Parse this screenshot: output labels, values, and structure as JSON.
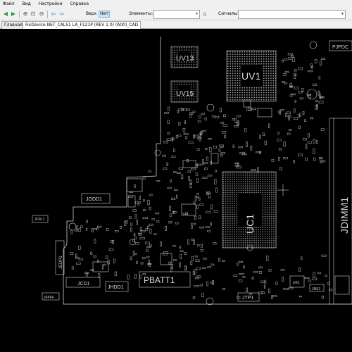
{
  "menu": [
    "Файл",
    "Вид",
    "Настройки",
    "Справка"
  ],
  "toolbar": {
    "side_label": "Верх",
    "side_value": "Нет",
    "elements_label": "Элементы:",
    "signals_label": "Сигналы:"
  },
  "tabs": [
    "Главная",
    "FixDevice NET_CAL51 LA_F121P (REV 1.0) (A00)_CAD"
  ],
  "board": {
    "components": [
      "UV13",
      "UV15",
      "UV1",
      "PJPDC",
      "JDIMM1",
      "UC1",
      "JFW 1",
      "JEDP1",
      "JCD1",
      "JODD1",
      "JHDD1",
      "PBATT1",
      "JTP1",
      "UK1",
      "JNS1",
      "JFPFF"
    ]
  },
  "colors": {
    "canvas": "#000000",
    "outline": "#cfcfcf",
    "chrome": "#f0f0f0",
    "accent": "#cce4f7"
  }
}
